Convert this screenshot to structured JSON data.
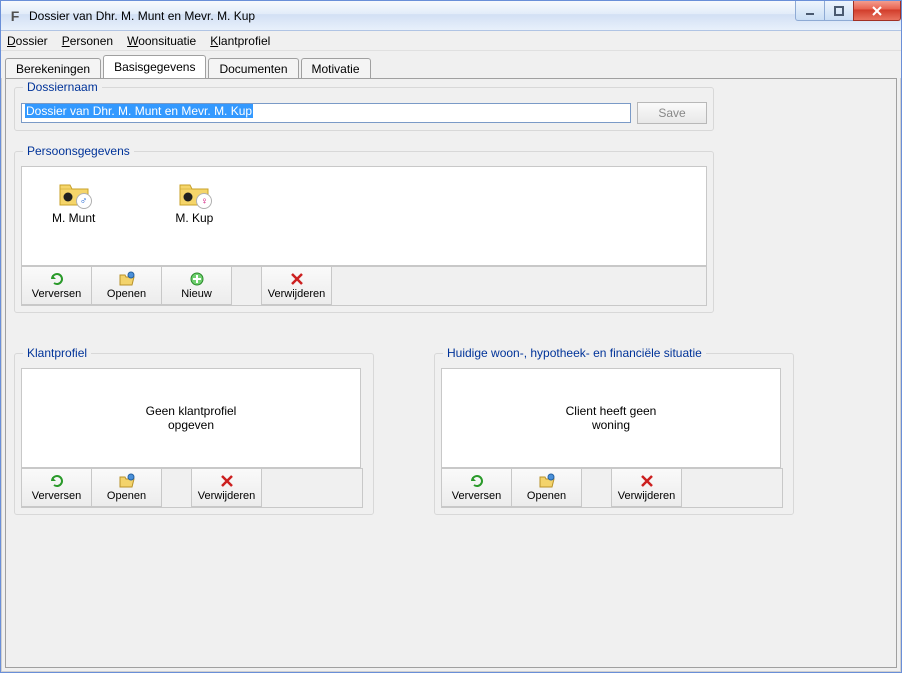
{
  "window": {
    "title": "Dossier van Dhr. M. Munt en Mevr. M. Kup"
  },
  "menu": {
    "dossier": "Dossier",
    "personen": "Personen",
    "woonsituatie": "Woonsituatie",
    "klantprofiel": "Klantprofiel"
  },
  "tabs": {
    "berekeningen": "Berekeningen",
    "basisgegevens": "Basisgegevens",
    "documenten": "Documenten",
    "motivatie": "Motivatie"
  },
  "dossiernaam": {
    "legend": "Dossiernaam",
    "value": "Dossier van Dhr. M. Munt en Mevr. M. Kup",
    "save_label": "Save"
  },
  "persoonsgegevens": {
    "legend": "Persoonsgegevens",
    "people": [
      {
        "name": "M. Munt",
        "gender": "m"
      },
      {
        "name": "M. Kup",
        "gender": "f"
      }
    ]
  },
  "buttons": {
    "verversen": "Verversen",
    "openen": "Openen",
    "nieuw": "Nieuw",
    "verwijderen": "Verwijderen"
  },
  "klantprofiel": {
    "legend": "Klantprofiel",
    "message": "Geen klantprofiel\nopgeven"
  },
  "woonsituatie": {
    "legend": "Huidige woon-, hypotheek- en financiële situatie",
    "message": "Client heeft geen\nwoning"
  }
}
